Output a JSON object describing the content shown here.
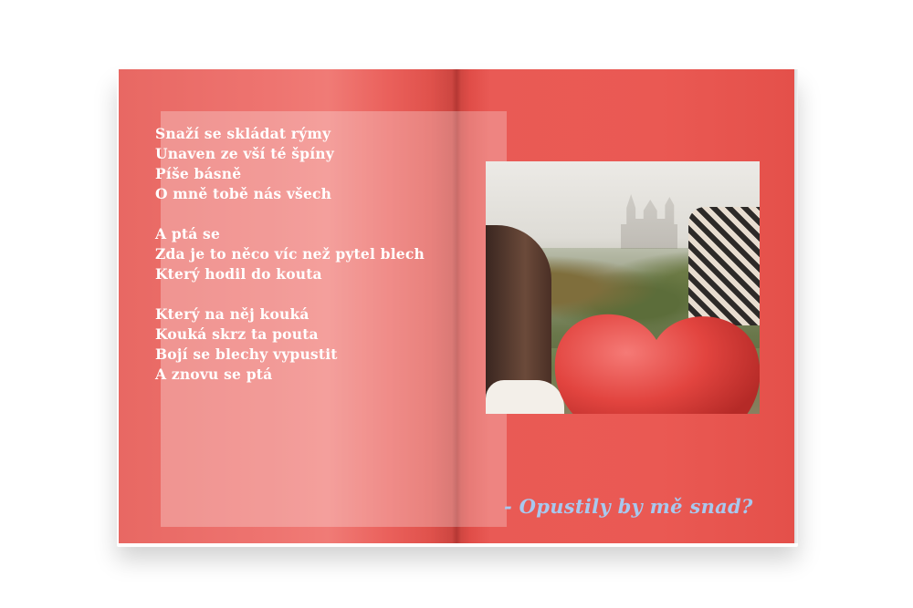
{
  "colors": {
    "page_background": "#ea5953",
    "poem_text": "#ffffff",
    "caption_text": "#a8c8ee"
  },
  "poem": {
    "stanzas": [
      {
        "lines": [
          "Snaží se skládat rýmy",
          "Unaven ze vší té špíny",
          "Píše básně",
          "O mně tobě nás všech"
        ]
      },
      {
        "lines": [
          "A ptá se",
          "Zda je to něco víc než pytel blech",
          "Který hodil do kouta"
        ]
      },
      {
        "lines": [
          "Který na něj kouká",
          "Kouká skrz ta pouta",
          "Bojí se blechy vypustit",
          "A znovu se ptá"
        ]
      }
    ]
  },
  "caption": "- Opustily by mě snad?"
}
